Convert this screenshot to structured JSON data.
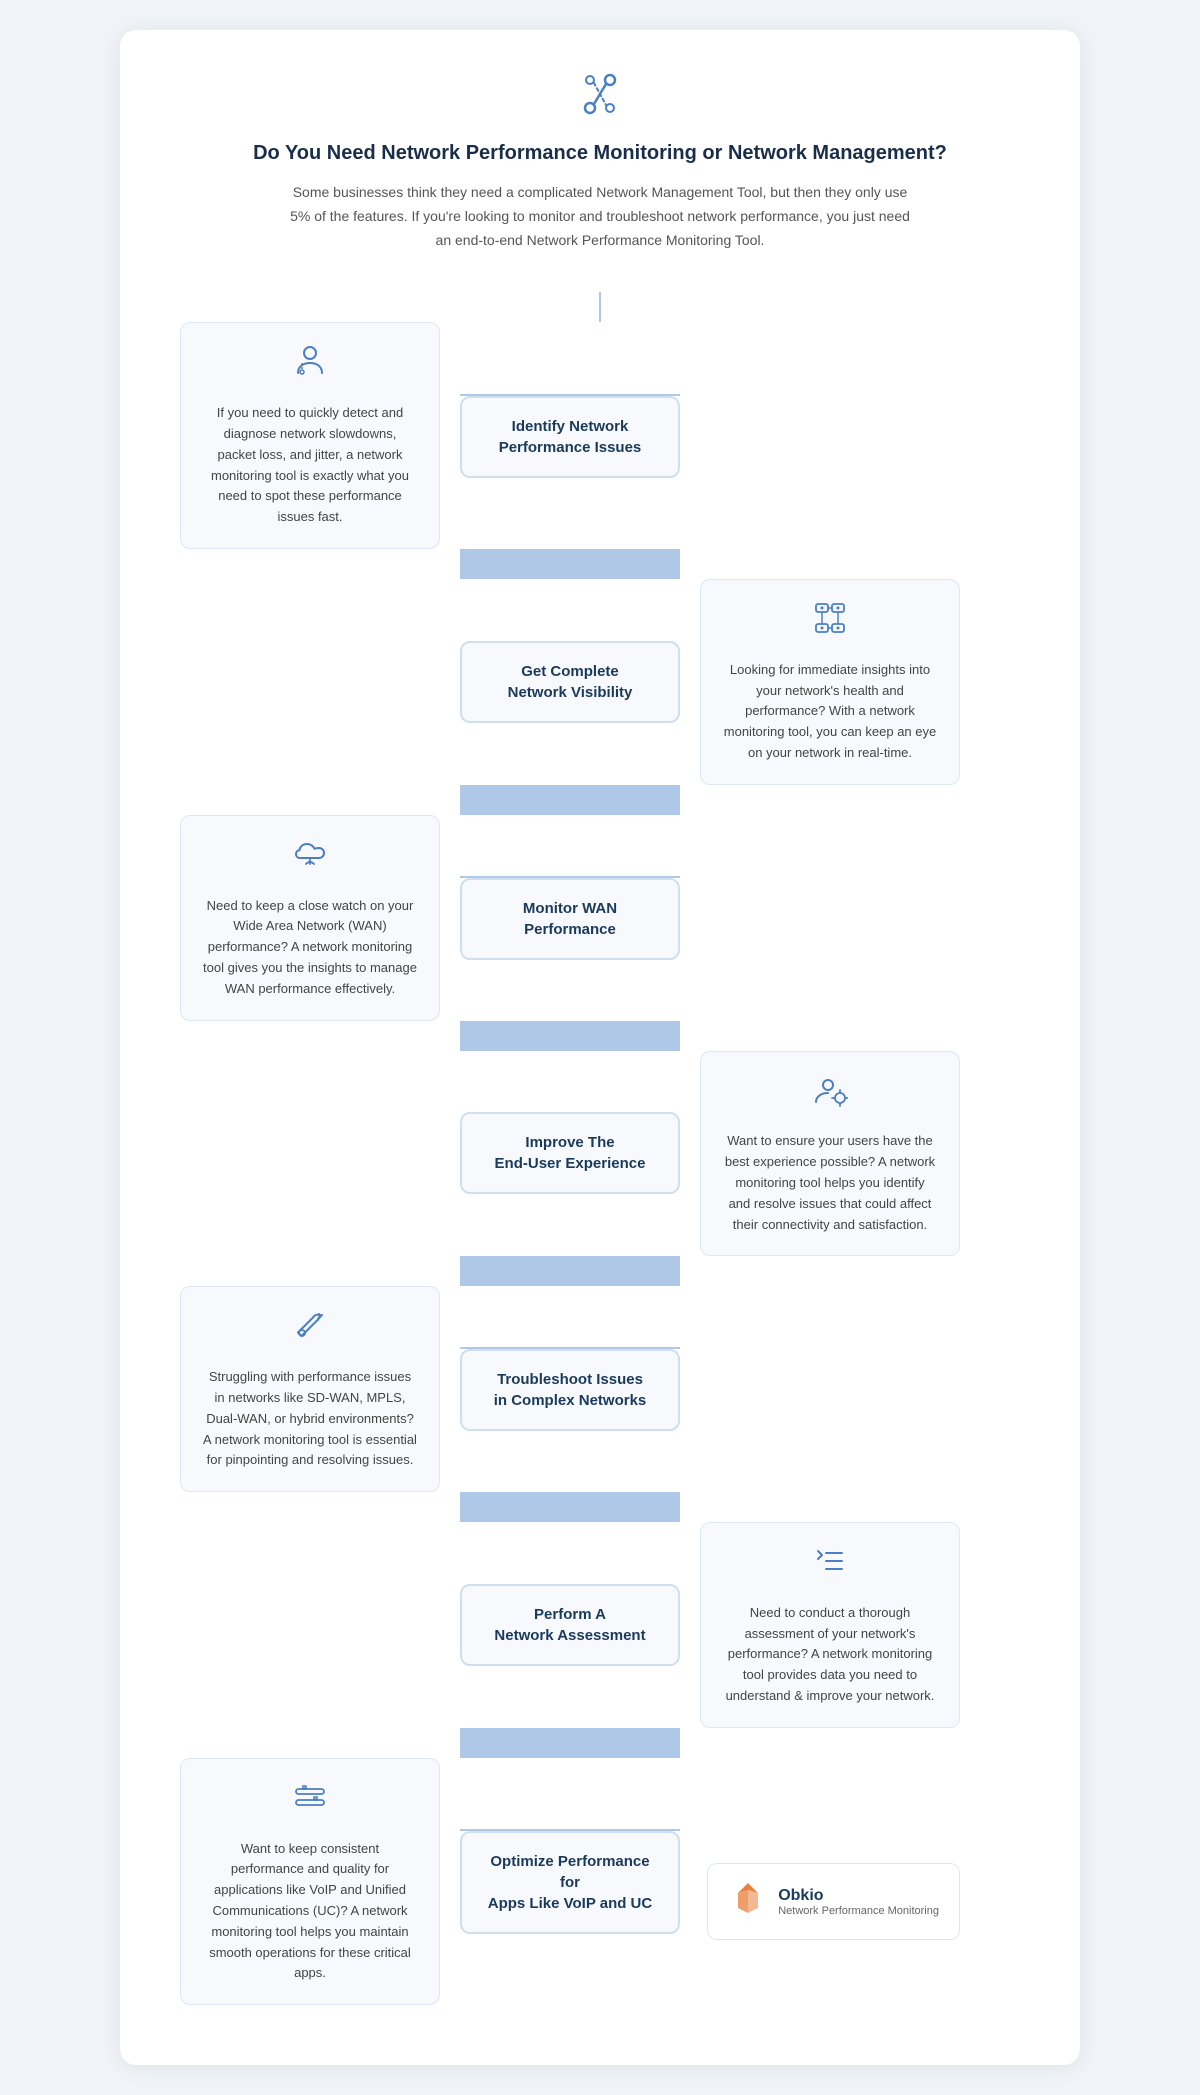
{
  "header": {
    "icon": "🔗",
    "title": "Do You Need Network Performance Monitoring or Network Management?",
    "description": "Some businesses think they need a complicated Network Management Tool, but then they only use 5% of the features. If you're looking to monitor and troubleshoot network performance, you just need an end-to-end Network Performance Monitoring Tool."
  },
  "nodes": [
    {
      "id": "node1",
      "label": "Identify Network\nPerformance Issues",
      "side": "left",
      "card_text": "If you need to quickly detect and diagnose network slowdowns, packet loss, and jitter, a network monitoring tool is exactly what you need to spot these performance issues fast."
    },
    {
      "id": "node2",
      "label": "Get Complete\nNetwork Visibility",
      "side": "right",
      "card_text": "Looking for immediate insights into your network's health and performance? With a network monitoring tool, you can keep an eye on your network in real-time."
    },
    {
      "id": "node3",
      "label": "Monitor WAN\nPerformance",
      "side": "left",
      "card_text": "Need to keep a close watch on your Wide Area Network (WAN) performance? A network monitoring tool gives you the insights to manage WAN performance effectively."
    },
    {
      "id": "node4",
      "label": "Improve The\nEnd-User Experience",
      "side": "right",
      "card_text": "Want to ensure your users have the best experience possible? A network monitoring tool helps you identify and resolve issues that could affect their connectivity and satisfaction."
    },
    {
      "id": "node5",
      "label": "Troubleshoot Issues\nin Complex Networks",
      "side": "left",
      "card_text": "Struggling with performance issues in networks like SD-WAN, MPLS, Dual-WAN, or hybrid environments? A network monitoring tool is essential for pinpointing and resolving issues."
    },
    {
      "id": "node6",
      "label": "Perform A\nNetwork Assessment",
      "side": "right",
      "card_text": "Need to conduct a thorough assessment of your network's performance? A network monitoring tool provides data you need to understand & improve your network."
    },
    {
      "id": "node7",
      "label": "Optimize Performance for\nApps Like VoIP and UC",
      "side": "left",
      "card_text": "Want to keep consistent performance and quality for applications like VoIP and Unified Communications (UC)? A network monitoring tool helps you maintain smooth operations for these critical apps."
    }
  ],
  "obkio": {
    "name": "Obkio",
    "subtitle": "Network Performance Monitoring"
  }
}
